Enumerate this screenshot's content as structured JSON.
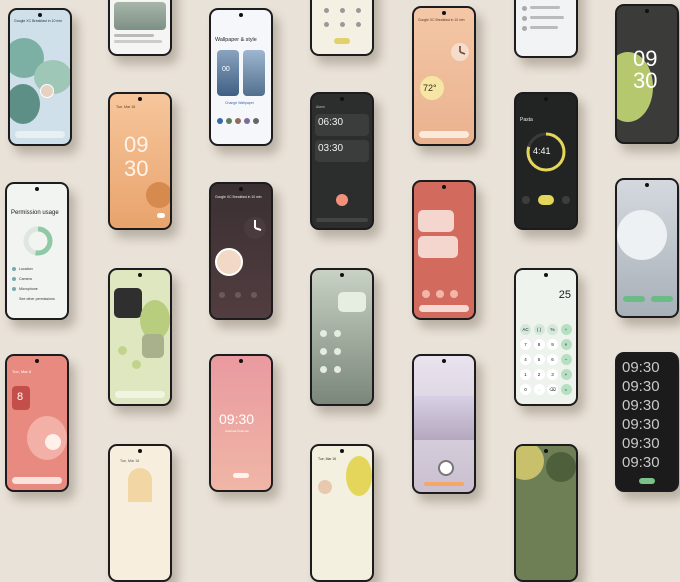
{
  "colors": {
    "background": "#e9e2d8",
    "bezel": "#1c1c1e",
    "accent_orange": "#f0a070",
    "accent_green": "#7cc08a",
    "accent_yellow": "#e3d65a"
  },
  "col1": {
    "a_lines": [
      "Google XC Breakfast in 10 min"
    ],
    "permission": {
      "title": "Permission usage",
      "items": [
        "Location",
        "Camera",
        "Microphone",
        "See other permissions"
      ]
    },
    "c_date": "Tue, Mar 8",
    "c_day": "8"
  },
  "col2": {
    "clock_date": "Tue, Mar 16",
    "clock_h": "09",
    "clock_m": "30",
    "d_date": "Tue, Mar 16"
  },
  "col3": {
    "wallpaper_title": "Wallpaper & style",
    "wallpaper_subtitle": "Change Wallpaper",
    "a_time": "00",
    "lock_line": "Google XC Breakfast in 10 min",
    "big_clock": "09:30",
    "big_clock_sub": "Gabriela Petersen"
  },
  "col4": {
    "alarm_label": "Alarm",
    "alarm1": "06:30",
    "alarm2": "03:30",
    "d_date": "Tue, Mar 16"
  },
  "col5": {
    "lock_line": "Google XC Breakfast in 10 min",
    "temp": "72°"
  },
  "col6": {
    "timer_label": "Pasta",
    "timer_value": "4:41",
    "calc_result": "25",
    "calc_keys": [
      "AC",
      "( )",
      "%",
      "÷",
      "7",
      "8",
      "9",
      "×",
      "4",
      "5",
      "6",
      "−",
      "1",
      "2",
      "3",
      "+",
      "0",
      ".",
      "⌫",
      "="
    ]
  },
  "col7": {
    "clock_h": "09",
    "clock_m": "30",
    "matrix": [
      "09:30",
      "09:30",
      "09:30",
      "09:30",
      "09:30",
      "09:30"
    ]
  }
}
